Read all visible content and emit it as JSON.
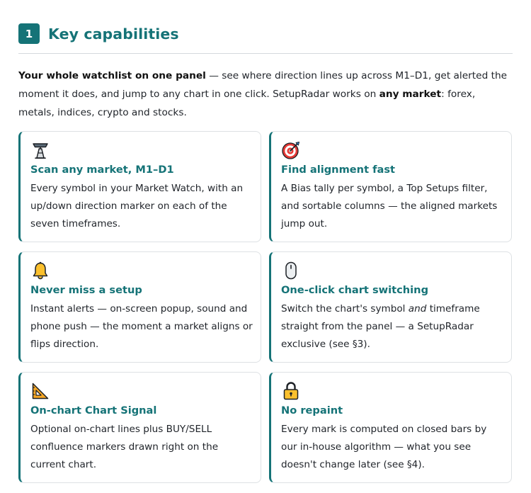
{
  "section": {
    "number": "1",
    "title": "Key capabilities"
  },
  "intro": {
    "bold_lead": "Your whole watchlist on one panel",
    "text1": " — see where direction lines up across M1–D1, get alerted the moment it does, and jump to any chart in one click. SetupRadar works on ",
    "bold_mid": "any market",
    "text2": ": forex, metals, indices, crypto and stocks."
  },
  "cards": [
    {
      "icon": "satellite-antenna-icon",
      "title": "Scan any market, M1–D1",
      "desc": "Every symbol in your Market Watch, with an up/down direction marker on each of the seven timeframes."
    },
    {
      "icon": "target-icon",
      "title": "Find alignment fast",
      "desc": "A Bias tally per symbol, a Top Setups filter, and sortable columns — the aligned markets jump out."
    },
    {
      "icon": "bell-icon",
      "title": "Never miss a setup",
      "desc": "Instant alerts — on-screen popup, sound and phone push — the moment a market aligns or flips direction."
    },
    {
      "icon": "mouse-icon",
      "title": "One-click chart switching",
      "desc_a": "Switch the chart's symbol ",
      "desc_em": "and",
      "desc_b": " timeframe straight from the panel — a SetupRadar exclusive (see §3)."
    },
    {
      "icon": "triangular-ruler-icon",
      "title": "On-chart Chart Signal",
      "desc": "Optional on-chart lines plus BUY/SELL confluence markers drawn right on the current chart."
    },
    {
      "icon": "lock-icon",
      "title": "No repaint",
      "desc": "Every mark is computed on closed bars by our in-house algorithm — what you see doesn't change later (see §4)."
    }
  ],
  "colors": {
    "accent": "#157377",
    "text": "#1f2329",
    "border": "#dde1e4"
  }
}
